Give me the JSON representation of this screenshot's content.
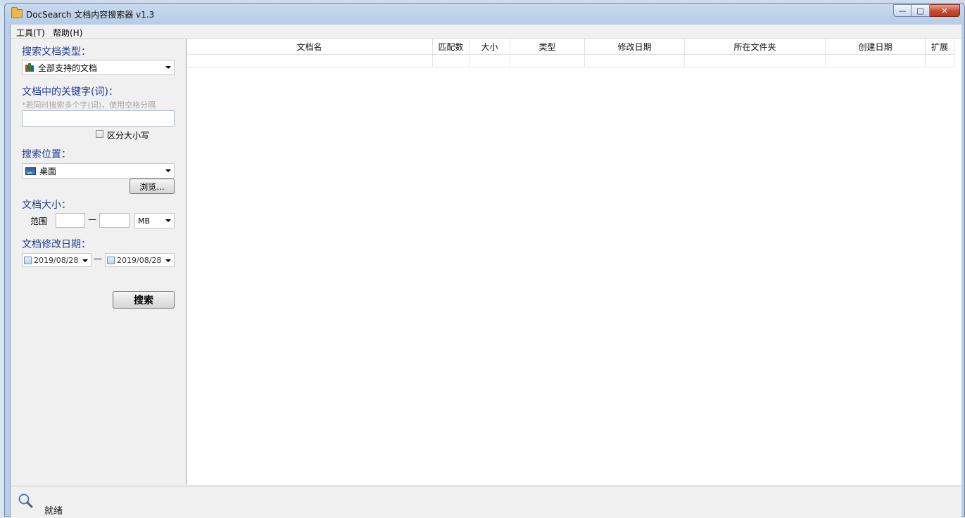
{
  "window": {
    "title": "DocSearch 文档内容搜索器 v1.3",
    "controls": {
      "minimize": "—",
      "maximize": "□",
      "close": "✕"
    }
  },
  "menu": [
    "工具(T)",
    "帮助(H)"
  ],
  "search_panel": {
    "doc_type_label": "搜索文档类型：",
    "doc_type_value": "全部支持的文档",
    "keyword_label": "文档中的关键字(词)：",
    "keyword_hint": "*若同时搜索多个字(词)，使用空格分隔",
    "keyword_value": "",
    "case_sensitive_label": "区分大小写",
    "location_label": "搜索位置：",
    "location_value": "桌面",
    "browse_button": "浏览...",
    "size_label": "文档大小：",
    "range_label": "范围",
    "range_from": "",
    "range_dash": "—",
    "range_to": "",
    "size_unit": "MB",
    "date_label": "文档修改日期：",
    "date_from": "2019/08/28",
    "date_dash": "—",
    "date_to": "2019/08/28",
    "search_button": "搜索"
  },
  "results_table": {
    "columns": [
      "文档名",
      "匹配数",
      "大小",
      "类型",
      "修改日期",
      "所在文件夹",
      "创建日期",
      "扩展"
    ],
    "rows": []
  },
  "status": {
    "text": "就绪"
  },
  "colors": {
    "accent_label": "#1f3b94",
    "hint": "#a8a8a8",
    "close_button": "#c94a2f"
  }
}
